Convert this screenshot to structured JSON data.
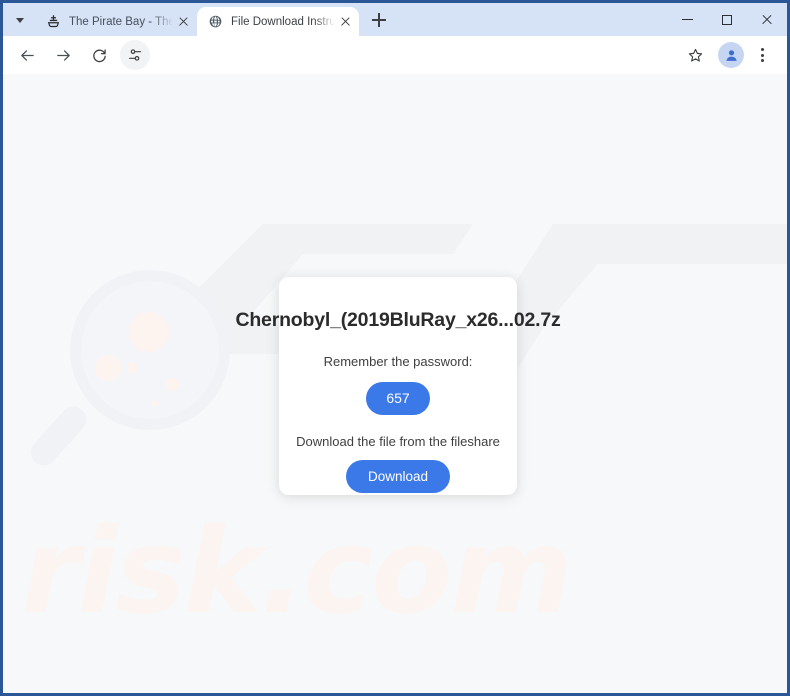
{
  "browser": {
    "tab_search_icon": "chevron-down-icon",
    "new_tab_label": "+",
    "tabs": [
      {
        "title": "The Pirate Bay - The galaxy's m",
        "favicon": "pirate-ship-icon",
        "active": false
      },
      {
        "title": "File Download Instructions for C",
        "favicon": "globe-icon",
        "active": true
      }
    ],
    "window_controls": {
      "minimize": "minimize-icon",
      "maximize": "maximize-icon",
      "close": "close-icon"
    },
    "toolbar": {
      "back": "back-arrow-icon",
      "forward": "forward-arrow-icon",
      "reload": "reload-icon",
      "tune": "tune-icon",
      "bookmark": "star-icon",
      "profile": "person-avatar-icon",
      "menu": "three-dot-menu-icon"
    }
  },
  "page": {
    "watermark_text": "risk.com",
    "watermark_logo": "magnifier-icon",
    "card": {
      "title": "Chernobyl_(2019BluRay_x26...02.7z",
      "password_label": "Remember the password:",
      "password_value": "657",
      "download_label": "Download the file from the fileshare",
      "download_button": "Download"
    }
  },
  "colors": {
    "accent_blue": "#3b79e8",
    "frame_blue": "#2c5796",
    "tabstrip": "#d6e2f5",
    "page_bg": "#f7f8f9",
    "watermark": "#fbf4f0"
  }
}
